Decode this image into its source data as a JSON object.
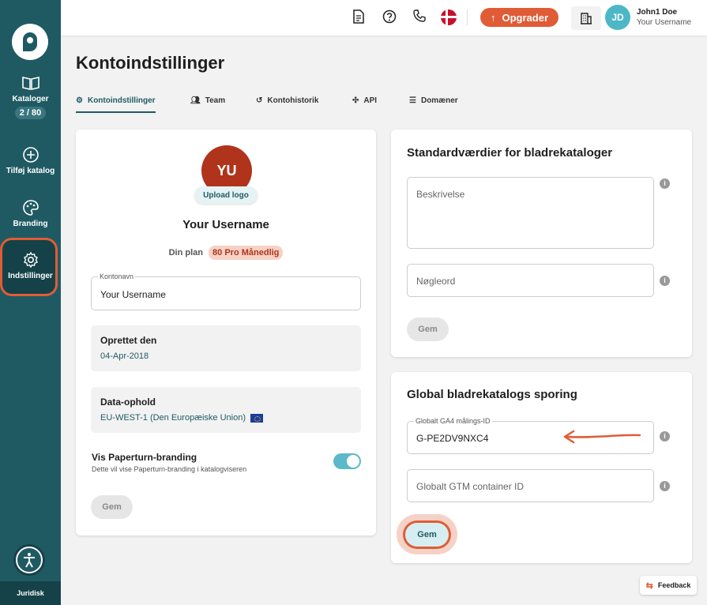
{
  "sidebar": {
    "items": [
      {
        "label": "Kataloger",
        "icon": "book-open-icon",
        "badge": "2 / 80"
      },
      {
        "label": "Tilføj katalog",
        "icon": "plus-circle-icon"
      },
      {
        "label": "Branding",
        "icon": "palette-icon"
      },
      {
        "label": "Indstillinger",
        "icon": "gear-icon"
      }
    ],
    "bottom_label": "Juridisk"
  },
  "topbar": {
    "upgrade_label": "Opgrader",
    "user": {
      "initials": "JD",
      "name": "John1 Doe",
      "username": "Your Username"
    }
  },
  "page": {
    "title": "Kontoindstillinger",
    "tabs": [
      {
        "label": "Kontoindstillinger",
        "icon": "gear-icon"
      },
      {
        "label": "Team",
        "icon": "users-icon"
      },
      {
        "label": "Kontohistorik",
        "icon": "history-icon"
      },
      {
        "label": "API",
        "icon": "api-icon"
      },
      {
        "label": "Domæner",
        "icon": "server-icon"
      }
    ]
  },
  "account": {
    "avatar_initials": "YU",
    "upload_label": "Upload logo",
    "username": "Your Username",
    "plan_label": "Din plan",
    "plan_value": "80 Pro Månedlig",
    "account_name_label": "Kontonavn",
    "account_name_value": "Your Username",
    "created_label": "Oprettet den",
    "created_value": "04-Apr-2018",
    "data_label": "Data-ophold",
    "data_value": "EU-WEST-1 (Den Europæiske Union)",
    "branding_title": "Vis Paperturn-branding",
    "branding_sub": "Dette vil vise Paperturn-branding i katalogviseren",
    "save_label": "Gem"
  },
  "defaults": {
    "title": "Standardværdier for bladrekataloger",
    "description_placeholder": "Beskrivelse",
    "keywords_placeholder": "Nøgleord",
    "save_label": "Gem"
  },
  "tracking": {
    "title": "Global bladrekatalogs sporing",
    "ga4_label": "Globalt GA4 målings-ID",
    "ga4_value": "G-PE2DV9NXC4",
    "gtm_placeholder": "Globalt GTM container ID",
    "save_label": "Gem"
  },
  "feedback_label": "Feedback",
  "colors": {
    "sidebar": "#1f5a63",
    "accent": "#e05c36",
    "teal": "#4db7c6"
  }
}
